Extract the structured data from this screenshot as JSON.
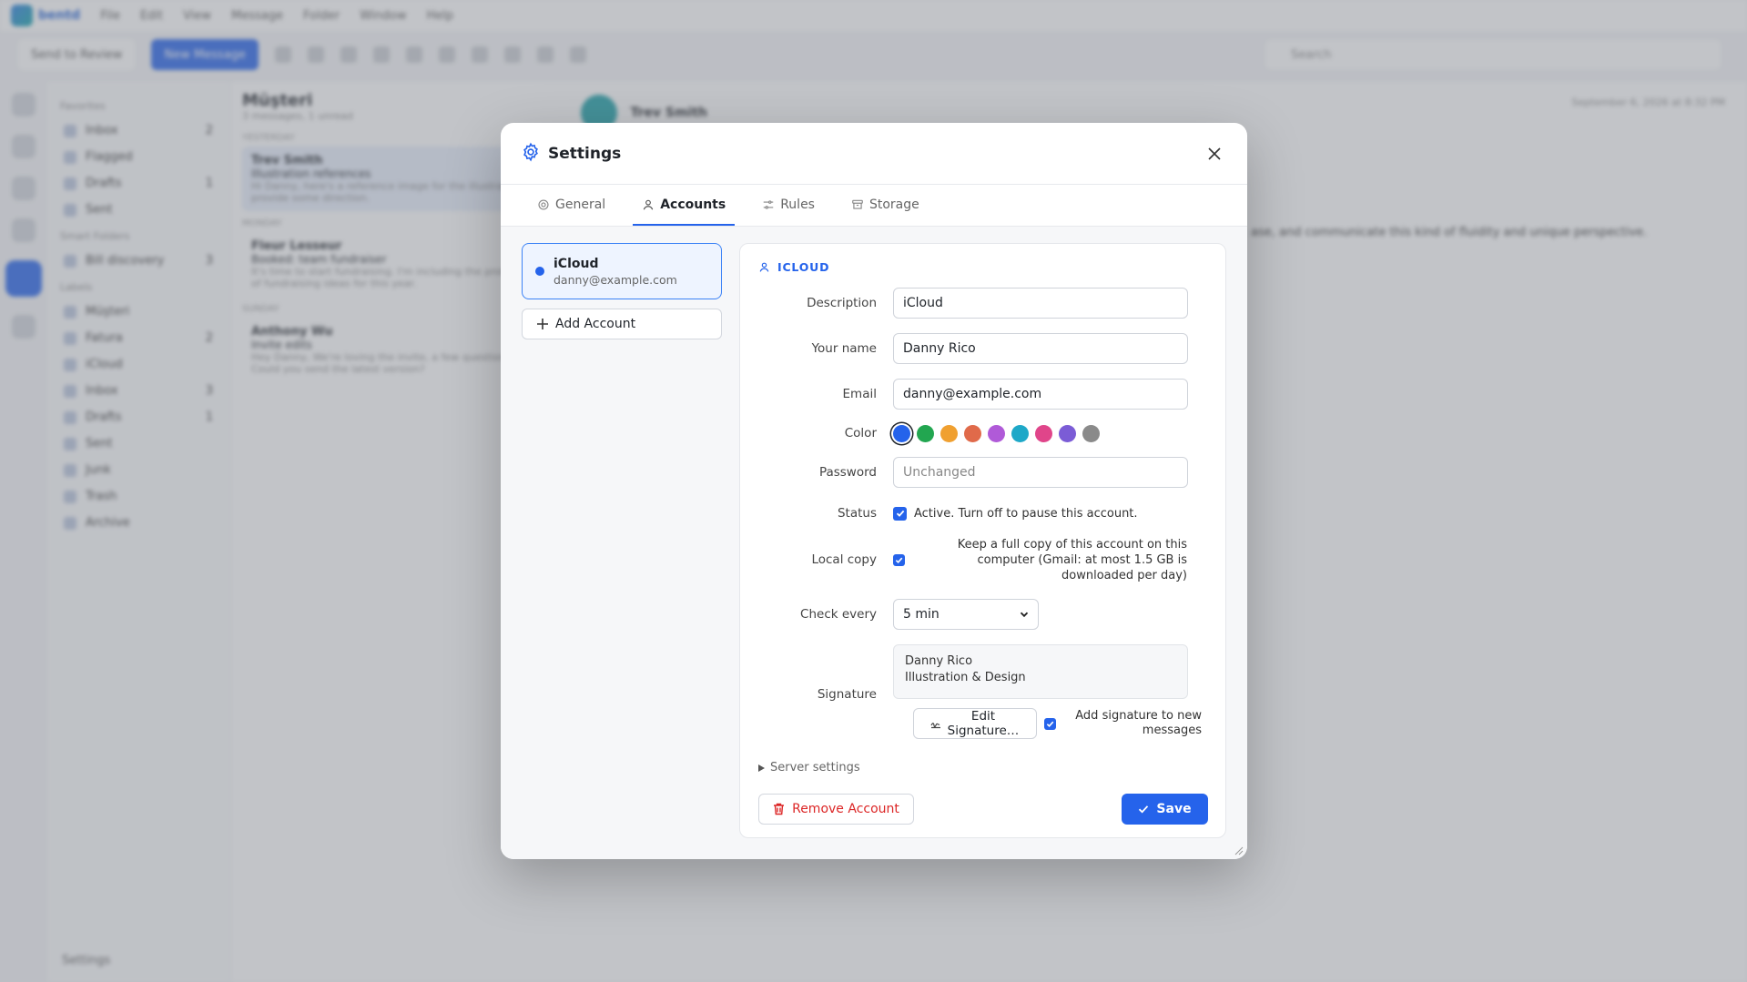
{
  "app": {
    "brand": "bentd",
    "menu": [
      "File",
      "Edit",
      "View",
      "Message",
      "Folder",
      "Window",
      "Help"
    ],
    "toolbar": {
      "send_review": "Send to Review",
      "new_message": "New Message"
    },
    "search_placeholder": "Search"
  },
  "sidebar": {
    "favorites_title": "Favorites",
    "favorites": [
      {
        "label": "Inbox",
        "count": "2"
      },
      {
        "label": "Flagged",
        "count": ""
      },
      {
        "label": "Drafts",
        "count": "1"
      },
      {
        "label": "Sent",
        "count": ""
      }
    ],
    "smart_title": "Smart Folders",
    "smart": [
      {
        "label": "Bill discovery",
        "count": "3"
      }
    ],
    "labels_title": "Labels",
    "labels": [
      {
        "label": "Müşteri",
        "count": "",
        "active": true
      },
      {
        "label": "Fatura",
        "count": "2",
        "active": false
      },
      {
        "label": "iCloud",
        "count": "",
        "active": false
      },
      {
        "label": "Inbox",
        "count": "3",
        "active": false
      },
      {
        "label": "Drafts",
        "count": "1",
        "active": false
      },
      {
        "label": "Sent",
        "count": "",
        "active": false
      },
      {
        "label": "Junk",
        "count": "",
        "active": false
      },
      {
        "label": "Trash",
        "count": "",
        "active": false
      },
      {
        "label": "Archive",
        "count": "",
        "active": false
      }
    ],
    "footer": "Settings"
  },
  "message_list": {
    "title": "Müşteri",
    "subtitle": "3 messages, 1 unread",
    "groups": [
      {
        "name": "YESTERDAY",
        "items": [
          {
            "from": "Trev Smith",
            "subject": "Illustration references",
            "snippet": "Hi Danny, here's a reference image for the illustration to provide some direction."
          }
        ]
      },
      {
        "name": "MONDAY",
        "items": [
          {
            "from": "Fleur Lesseur",
            "subject": "Booked: team fundraiser",
            "snippet": "It's time to start fundraising. I'm including the prototype of fundraising ideas for this year."
          }
        ]
      },
      {
        "name": "SUNDAY",
        "items": [
          {
            "from": "Anthony Wu",
            "subject": "Invite edits",
            "snippet": "Hey Danny, We're loving the invite, a few questions. Could you send the latest version?"
          }
        ]
      }
    ]
  },
  "reader": {
    "from": "Trev Smith",
    "subject": "Illustration references",
    "date": "September 6, 2026 at 8:32 PM",
    "body": "ase, and communicate this kind of fluidity and unique perspective."
  },
  "settings": {
    "title": "Settings",
    "tabs": [
      {
        "label": "General",
        "icon": "gear-icon",
        "active": false
      },
      {
        "label": "Accounts",
        "icon": "user-icon",
        "active": true
      },
      {
        "label": "Rules",
        "icon": "sliders-icon",
        "active": false
      },
      {
        "label": "Storage",
        "icon": "archive-icon",
        "active": false
      }
    ],
    "account_card": {
      "name": "iCloud",
      "email": "danny@example.com",
      "color": "#2563eb"
    },
    "add_account": "Add Account",
    "panel": {
      "heading": "ICLOUD",
      "description_label": "Description",
      "description_value": "iCloud",
      "name_label": "Your name",
      "name_value": "Danny Rico",
      "email_label": "Email",
      "email_value": "danny@example.com",
      "color_label": "Color",
      "colors": [
        "#2563eb",
        "#22a650",
        "#f0a030",
        "#e06a4a",
        "#b05ad8",
        "#1ea8c8",
        "#e0458a",
        "#7b5cd6",
        "#8a8a8a"
      ],
      "password_label": "Password",
      "password_placeholder": "Unchanged",
      "status_label": "Status",
      "status_text": "Active. Turn off to pause this account.",
      "local_label": "Local copy",
      "local_text": "Keep a full copy of this account on this computer (Gmail: at most 1.5 GB is downloaded per day)",
      "check_label": "Check every",
      "check_value": "5 min",
      "signature_label": "Signature",
      "signature_line1": "Danny Rico",
      "signature_line2": "Illustration & Design",
      "edit_signature": "Edit Signature…",
      "add_signature_text": "Add signature to new messages",
      "server_settings": "Server settings",
      "remove_account": "Remove Account",
      "save": "Save"
    }
  }
}
